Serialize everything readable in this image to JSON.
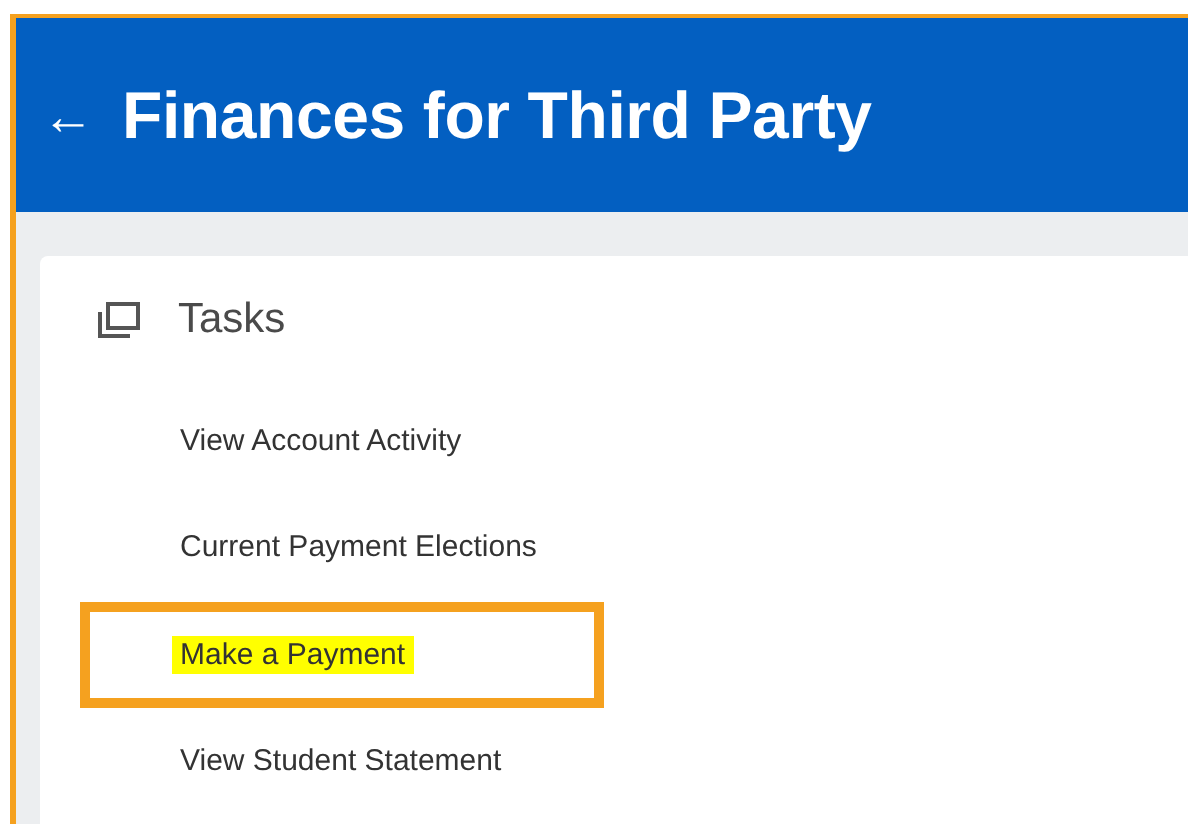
{
  "header": {
    "back_icon": "←",
    "title": "Finances for Third Party"
  },
  "tasks": {
    "title": "Tasks",
    "items": [
      {
        "label": "View Account Activity",
        "highlighted": false
      },
      {
        "label": "Current Payment Elections",
        "highlighted": false
      },
      {
        "label": "Make a Payment",
        "highlighted": true
      },
      {
        "label": "View Student Statement",
        "highlighted": false
      }
    ]
  }
}
